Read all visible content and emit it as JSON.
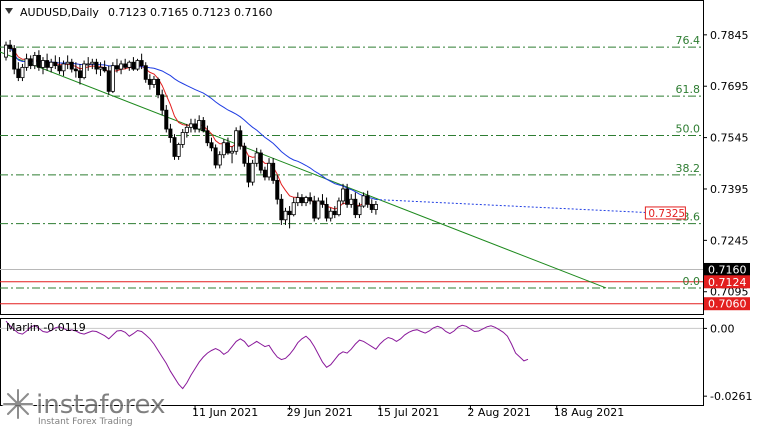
{
  "chart_data": {
    "type": "candlestick",
    "main": {
      "symbol_label": "AUDUSD,Daily",
      "ohlc_label": "0.7123 0.7165 0.7123 0.7160",
      "ylim": [
        0.703,
        0.7935
      ],
      "y_ticks": [
        "0.7845",
        "0.7695",
        "0.7545",
        "0.7395",
        "0.7245",
        "0.7095"
      ],
      "x_ticks": [
        {
          "label": "11 Jun 2021",
          "bar": 46
        },
        {
          "label": "29 Jun 2021",
          "bar": 69
        },
        {
          "label": "15 Jul 2021",
          "bar": 91
        },
        {
          "label": "2 Aug 2021",
          "bar": 113
        },
        {
          "label": "18 Aug 2021",
          "bar": 134
        }
      ],
      "price_labels": [
        {
          "text": "0.7160",
          "value": 0.716,
          "bg": "#000000",
          "fg": "#ffffff"
        },
        {
          "text": "0.7124",
          "value": 0.7124,
          "bg": "#e31f1f",
          "fg": "#ffffff"
        },
        {
          "text": "0.7060",
          "value": 0.706,
          "bg": "#e31f1f",
          "fg": "#ffffff"
        }
      ],
      "marker": {
        "text": "0.7325",
        "value": 0.7325,
        "bar": 158
      },
      "fib_levels": [
        {
          "label": "76.4",
          "value": 0.7809
        },
        {
          "label": "61.8",
          "value": 0.7666
        },
        {
          "label": "50.0",
          "value": 0.7551
        },
        {
          "label": "38.2",
          "value": 0.7436
        },
        {
          "label": "23.6",
          "value": 0.7294
        },
        {
          "label": "0.0",
          "value": 0.7106
        }
      ],
      "hlines": [
        {
          "value": 0.716,
          "color": "#b8b8b8"
        },
        {
          "value": 0.7124,
          "color": "#e31f1f"
        },
        {
          "value": 0.706,
          "color": "#e31f1f"
        }
      ],
      "trendline": {
        "from": {
          "bar": 0,
          "value": 0.7795
        },
        "to": {
          "bar": 146,
          "value": 0.7106
        }
      },
      "candles": [
        [
          0.778,
          0.7825,
          0.777,
          0.7815
        ],
        [
          0.7815,
          0.783,
          0.7795,
          0.7805
        ],
        [
          0.7805,
          0.7815,
          0.773,
          0.7745
        ],
        [
          0.7745,
          0.7765,
          0.771,
          0.772
        ],
        [
          0.772,
          0.776,
          0.771,
          0.775
        ],
        [
          0.775,
          0.779,
          0.774,
          0.7775
        ],
        [
          0.7775,
          0.7785,
          0.7745,
          0.7755
        ],
        [
          0.7755,
          0.7795,
          0.7745,
          0.7785
        ],
        [
          0.7785,
          0.78,
          0.774,
          0.775
        ],
        [
          0.775,
          0.778,
          0.773,
          0.777
        ],
        [
          0.777,
          0.779,
          0.774,
          0.775
        ],
        [
          0.775,
          0.7775,
          0.7735,
          0.7765
        ],
        [
          0.7765,
          0.7785,
          0.7745,
          0.7755
        ],
        [
          0.7755,
          0.778,
          0.773,
          0.774
        ],
        [
          0.774,
          0.777,
          0.7725,
          0.776
        ],
        [
          0.776,
          0.7785,
          0.7745,
          0.7765
        ],
        [
          0.7765,
          0.7775,
          0.7735,
          0.7745
        ],
        [
          0.7745,
          0.7765,
          0.772,
          0.774
        ],
        [
          0.774,
          0.776,
          0.77,
          0.772
        ],
        [
          0.772,
          0.777,
          0.7715,
          0.776
        ],
        [
          0.776,
          0.778,
          0.774,
          0.776
        ],
        [
          0.776,
          0.7775,
          0.7745,
          0.7765
        ],
        [
          0.7765,
          0.7775,
          0.773,
          0.7745
        ],
        [
          0.7745,
          0.7765,
          0.7725,
          0.775
        ],
        [
          0.775,
          0.777,
          0.7735,
          0.774
        ],
        [
          0.774,
          0.7755,
          0.767,
          0.768
        ],
        [
          0.768,
          0.7765,
          0.7675,
          0.7755
        ],
        [
          0.7755,
          0.7775,
          0.7735,
          0.7745
        ],
        [
          0.7745,
          0.777,
          0.773,
          0.776
        ],
        [
          0.776,
          0.7775,
          0.7745,
          0.775
        ],
        [
          0.775,
          0.777,
          0.774,
          0.7765
        ],
        [
          0.7765,
          0.778,
          0.774,
          0.7745
        ],
        [
          0.7745,
          0.7775,
          0.774,
          0.777
        ],
        [
          0.777,
          0.779,
          0.7745,
          0.7755
        ],
        [
          0.7755,
          0.7765,
          0.7705,
          0.7715
        ],
        [
          0.7715,
          0.773,
          0.7685,
          0.77
        ],
        [
          0.77,
          0.7725,
          0.769,
          0.7715
        ],
        [
          0.7715,
          0.772,
          0.766,
          0.767
        ],
        [
          0.767,
          0.7685,
          0.761,
          0.7625
        ],
        [
          0.7625,
          0.764,
          0.756,
          0.757
        ],
        [
          0.757,
          0.7585,
          0.753,
          0.7545
        ],
        [
          0.7545,
          0.7555,
          0.748,
          0.749
        ],
        [
          0.749,
          0.753,
          0.748,
          0.7525
        ],
        [
          0.7525,
          0.757,
          0.7515,
          0.756
        ],
        [
          0.756,
          0.7585,
          0.7545,
          0.7575
        ],
        [
          0.7575,
          0.76,
          0.756,
          0.7585
        ],
        [
          0.7585,
          0.76,
          0.756,
          0.757
        ],
        [
          0.757,
          0.761,
          0.756,
          0.7595
        ],
        [
          0.7595,
          0.7605,
          0.756,
          0.7565
        ],
        [
          0.7565,
          0.758,
          0.752,
          0.753
        ],
        [
          0.753,
          0.7545,
          0.7505,
          0.7515
        ],
        [
          0.7515,
          0.7525,
          0.7455,
          0.7465
        ],
        [
          0.7465,
          0.7505,
          0.7455,
          0.7495
        ],
        [
          0.7495,
          0.754,
          0.7485,
          0.753
        ],
        [
          0.753,
          0.7545,
          0.7495,
          0.75
        ],
        [
          0.75,
          0.752,
          0.747,
          0.7505
        ],
        [
          0.7505,
          0.7575,
          0.7495,
          0.7565
        ],
        [
          0.7565,
          0.758,
          0.751,
          0.752
        ],
        [
          0.752,
          0.753,
          0.746,
          0.747
        ],
        [
          0.747,
          0.749,
          0.74,
          0.7415
        ],
        [
          0.7415,
          0.748,
          0.7405,
          0.747
        ],
        [
          0.747,
          0.7515,
          0.746,
          0.75
        ],
        [
          0.75,
          0.751,
          0.744,
          0.745
        ],
        [
          0.745,
          0.746,
          0.742,
          0.743
        ],
        [
          0.743,
          0.7485,
          0.742,
          0.747
        ],
        [
          0.747,
          0.7485,
          0.741,
          0.742
        ],
        [
          0.742,
          0.7435,
          0.735,
          0.7365
        ],
        [
          0.7365,
          0.738,
          0.729,
          0.7305
        ],
        [
          0.7305,
          0.734,
          0.729,
          0.733
        ],
        [
          0.733,
          0.7345,
          0.728,
          0.732
        ],
        [
          0.732,
          0.737,
          0.7315,
          0.7355
        ],
        [
          0.7355,
          0.7385,
          0.7345,
          0.737
        ],
        [
          0.737,
          0.738,
          0.7345,
          0.7355
        ],
        [
          0.7355,
          0.7375,
          0.7345,
          0.737
        ],
        [
          0.737,
          0.7385,
          0.735,
          0.736
        ],
        [
          0.736,
          0.7375,
          0.73,
          0.731
        ],
        [
          0.731,
          0.737,
          0.7305,
          0.736
        ],
        [
          0.736,
          0.738,
          0.734,
          0.735
        ],
        [
          0.735,
          0.737,
          0.73,
          0.731
        ],
        [
          0.731,
          0.734,
          0.73,
          0.733
        ],
        [
          0.733,
          0.7345,
          0.731,
          0.732
        ],
        [
          0.732,
          0.737,
          0.7315,
          0.736
        ],
        [
          0.736,
          0.741,
          0.735,
          0.7395
        ],
        [
          0.7395,
          0.741,
          0.734,
          0.735
        ],
        [
          0.735,
          0.738,
          0.734,
          0.7365
        ],
        [
          0.7365,
          0.7385,
          0.731,
          0.732
        ],
        [
          0.732,
          0.7355,
          0.731,
          0.7345
        ],
        [
          0.7345,
          0.7385,
          0.734,
          0.7375
        ],
        [
          0.7375,
          0.739,
          0.734,
          0.735
        ],
        [
          0.735,
          0.7365,
          0.7325,
          0.7335
        ],
        [
          0.7335,
          0.736,
          0.732,
          0.735
        ]
      ]
    },
    "indicator": {
      "label": "Marlin -0.0119",
      "ylim": [
        -0.0295,
        0.004
      ],
      "y_ticks": [
        "0.00",
        "-0.0261"
      ],
      "zero_line": 0.0,
      "values": [
        0.0028,
        0.001,
        -0.0005,
        -0.0018,
        -0.0022,
        -0.001,
        0.0005,
        0.0012,
        0.0,
        -0.0012,
        -0.0015,
        -0.0008,
        0.0002,
        0.0006,
        0.0,
        -0.0008,
        -0.0006,
        -0.001,
        -0.0018,
        -0.0022,
        -0.0016,
        -0.001,
        -0.0012,
        -0.002,
        -0.0028,
        -0.004,
        -0.0025,
        -0.001,
        -0.0008,
        -0.0015,
        -0.003,
        -0.002,
        -0.0008,
        -0.0012,
        -0.0025,
        -0.004,
        -0.006,
        -0.0085,
        -0.011,
        -0.0135,
        -0.0165,
        -0.019,
        -0.0215,
        -0.0232,
        -0.021,
        -0.018,
        -0.0155,
        -0.013,
        -0.011,
        -0.0095,
        -0.0085,
        -0.0078,
        -0.0085,
        -0.01,
        -0.009,
        -0.007,
        -0.005,
        -0.004,
        -0.005,
        -0.007,
        -0.006,
        -0.005,
        -0.006,
        -0.007,
        -0.0065,
        -0.009,
        -0.011,
        -0.012,
        -0.0115,
        -0.01,
        -0.008,
        -0.0055,
        -0.004,
        -0.003,
        -0.0045,
        -0.007,
        -0.01,
        -0.013,
        -0.015,
        -0.014,
        -0.012,
        -0.01,
        -0.009,
        -0.0095,
        -0.008,
        -0.006,
        -0.0045,
        -0.005,
        -0.006,
        -0.007,
        -0.008,
        -0.006,
        -0.0045,
        -0.0035,
        -0.004,
        -0.005,
        -0.004,
        -0.0025,
        -0.0015,
        -0.0008,
        -0.0005,
        -0.0012,
        -0.0018,
        -0.001,
        0.0002,
        0.0008,
        0.0002,
        -0.0012,
        -0.002,
        -0.001,
        0.0005,
        0.0012,
        0.0008,
        -0.0002,
        -0.0012,
        -0.001,
        -0.0002,
        0.0006,
        0.001,
        0.0004,
        -0.0005,
        -0.0015,
        -0.003,
        -0.006,
        -0.0095,
        -0.011,
        -0.0125,
        -0.0119
      ]
    }
  },
  "watermark": {
    "brand": "instaforex",
    "tagline": "Instant Forex Trading"
  }
}
